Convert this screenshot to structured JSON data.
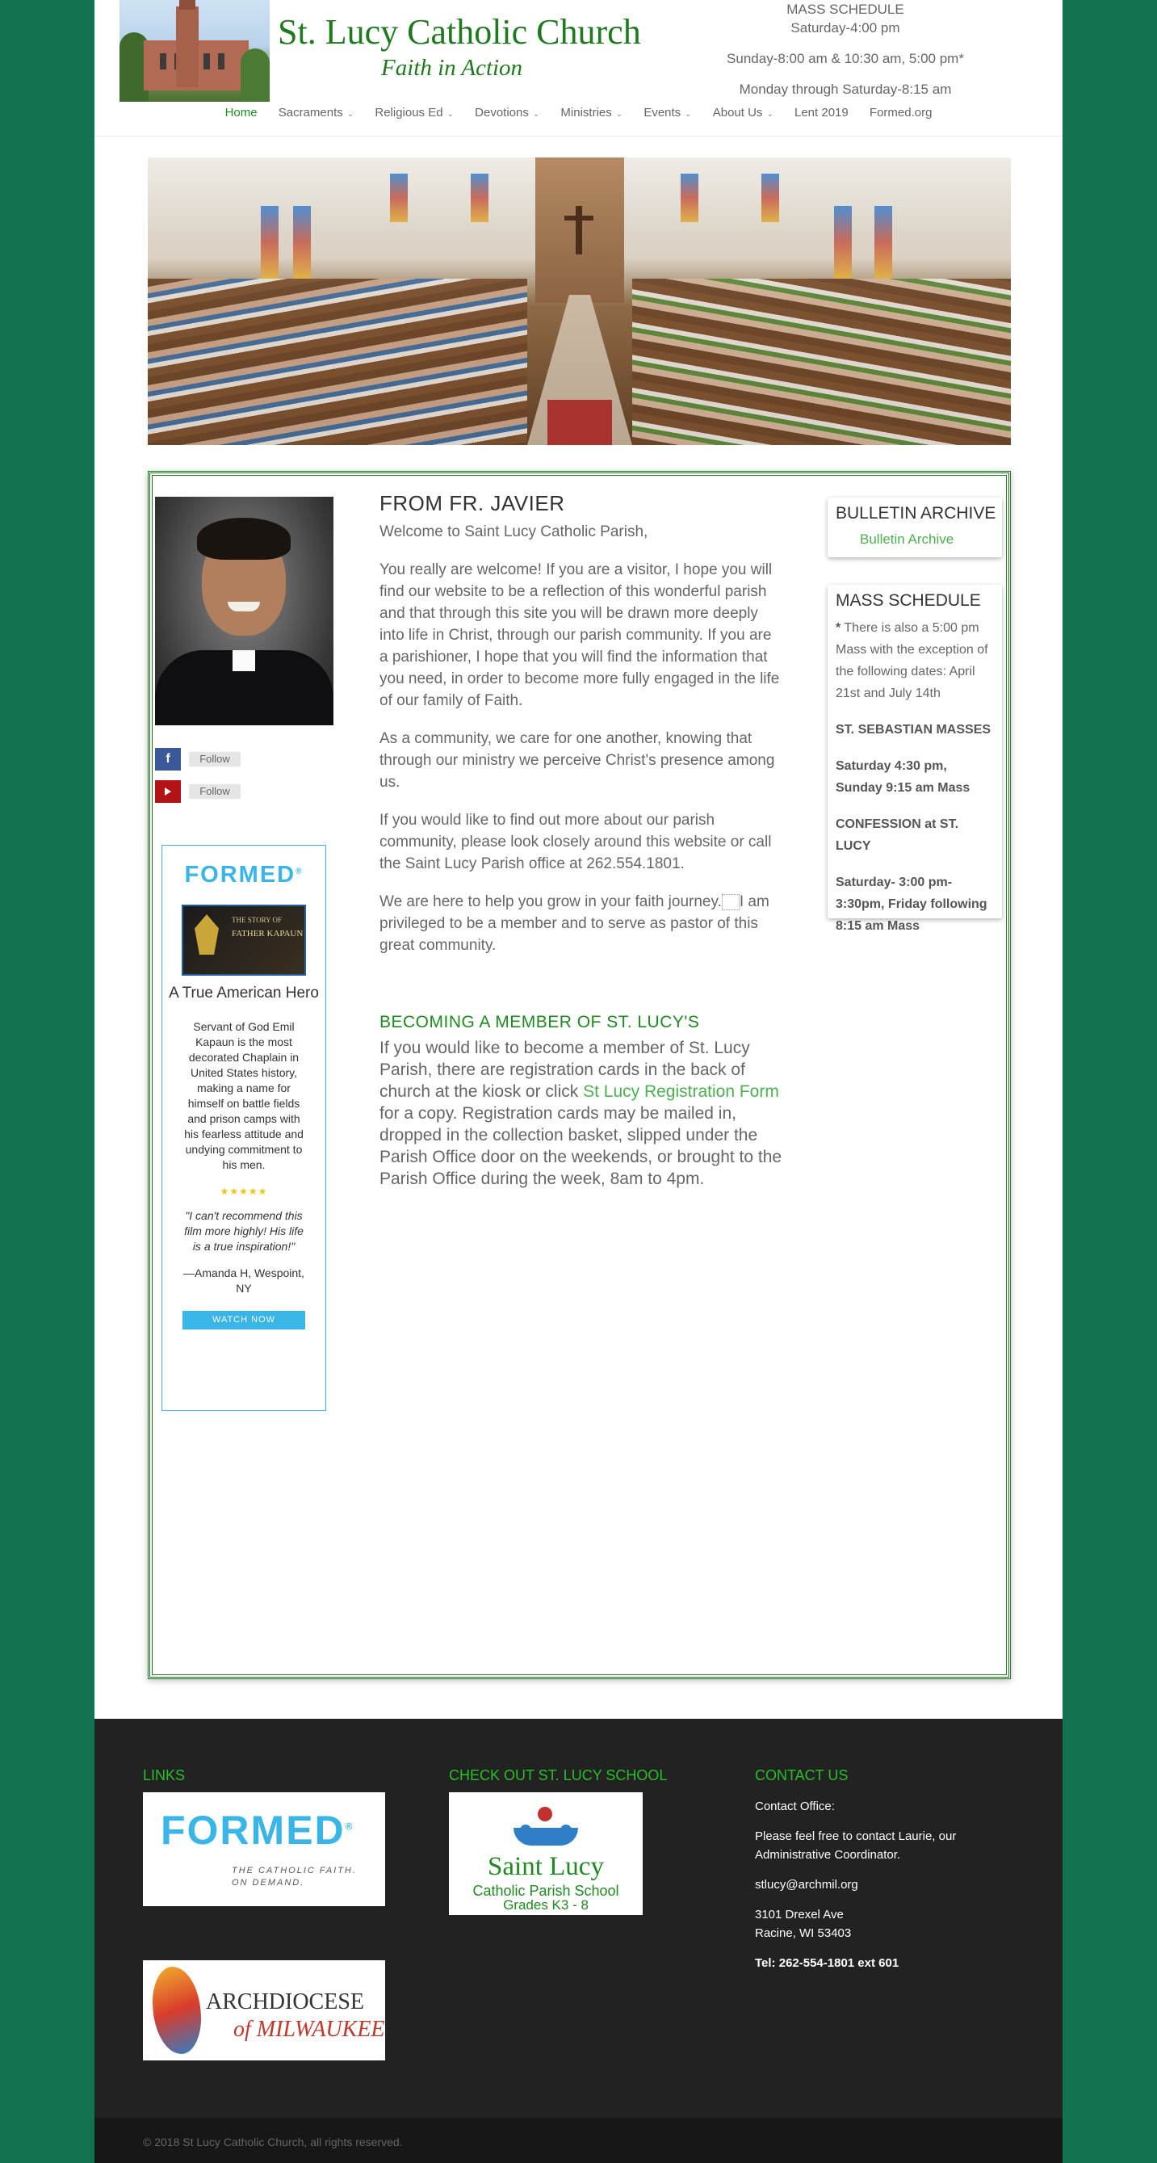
{
  "header": {
    "site_title": "St. Lucy Catholic Church",
    "tagline": "Faith in Action",
    "mass_schedule": {
      "heading": "MASS SCHEDULE",
      "saturday": "Saturday-4:00 pm",
      "sunday": "Sunday-8:00 am & 10:30 am, 5:00 pm*",
      "weekday": "Monday through Saturday-8:15 am"
    }
  },
  "nav": {
    "items": [
      {
        "label": "Home",
        "dropdown": false,
        "active": true
      },
      {
        "label": "Sacraments",
        "dropdown": true
      },
      {
        "label": "Religious Ed",
        "dropdown": true
      },
      {
        "label": "Devotions",
        "dropdown": true
      },
      {
        "label": "Ministries",
        "dropdown": true
      },
      {
        "label": "Events",
        "dropdown": true
      },
      {
        "label": "About Us",
        "dropdown": true
      },
      {
        "label": "Lent 2019",
        "dropdown": false
      },
      {
        "label": "Formed.org",
        "dropdown": false
      }
    ],
    "chevron_icon": "chevron-down-icon"
  },
  "sidebar": {
    "social": {
      "facebook": {
        "icon": "facebook-icon",
        "glyph": "f",
        "label": "Follow"
      },
      "youtube": {
        "icon": "youtube-icon",
        "label": "Follow"
      }
    },
    "formed_widget": {
      "logo_text": "FORMED",
      "logo_mark": "®",
      "poster_line1": "THE STORY OF",
      "poster_line2": "FATHER KAPAUN",
      "title": "A True American Hero",
      "description": "Servant of God Emil Kapaun is the most decorated Chaplain in United States history, making a name for himself on battle fields and prison camps with his fearless attitude and undying commitment to his men.",
      "stars": "★★★★★",
      "rating": 5,
      "quote": "\"I can't recommend this film more highly! His life is a true inspiration!\"",
      "author": "—Amanda H, Wespoint, NY",
      "button_label": "WATCH NOW"
    }
  },
  "main": {
    "title": "FROM FR. JAVIER",
    "welcome": "Welcome to Saint Lucy Catholic Parish,",
    "para1": "You really are welcome!  If you are a visitor, I hope you will find our website to be a reflection of this wonderful parish and that through this site you will be drawn more deeply into life in Christ, through our parish community. If you are a parishioner, I hope that you will find the information that you need, in order to become more fully engaged in the life of our family of Faith.",
    "para2": "As a community, we care for one another, knowing that through our ministry we perceive Christ's presence among us.",
    "para3": "If you would like to find out more about our parish community, please look closely around this website or call the Saint Lucy Parish office at 262.554.1801.",
    "para4_a": "We are here to help you grow in your faith journey.",
    "para4_b": "I am privileged to be a member and to serve as pastor of this great community.",
    "member_heading": "BECOMING A MEMBER OF ST. LUCY'S",
    "member_text_a": "If you would like to become a member of St. Lucy Parish, there are registration cards in the back of church at the kiosk or click ",
    "member_link": "St Lucy Registration Form",
    "member_text_b": " for a copy. Registration cards may be mailed in, dropped in the collection basket, slipped under the Parish Office door on the weekends, or brought to the Parish Office during the week, 8am to 4pm."
  },
  "bulletin": {
    "title": "BULLETIN ARCHIVE",
    "link": "Bulletin Archive"
  },
  "mass_card": {
    "title": "MASS SCHEDULE",
    "star": "*",
    "note": " There is also a 5:00 pm Mass with the exception of the following dates: April 21st and July 14th",
    "sebastian_heading": "ST. SEBASTIAN MASSES",
    "sebastian_times": "Saturday 4:30 pm, Sunday 9:15 am Mass",
    "confession_heading": "CONFESSION at ST. LUCY",
    "confession_times": "Saturday- 3:00 pm-3:30pm, Friday following 8:15 am Mass"
  },
  "footer": {
    "links_heading": "LINKS",
    "formed_big": "FORMED",
    "formed_mark": "®",
    "formed_sub1": "THE CATHOLIC FAITH.",
    "formed_sub2": "ON DEMAND.",
    "arch_line1": "ARCHDIOCESE",
    "arch_line2": "of MILWAUKEE",
    "school_heading": "CHECK OUT ST. LUCY SCHOOL",
    "school_name": "Saint Lucy",
    "school_sub": "Catholic Parish School",
    "school_grades": "Grades K3 - 8",
    "contact_heading": "CONTACT US",
    "contact_office": "Contact Office:",
    "contact_note": "Please feel free to contact Laurie, our Administrative Coordinator.",
    "email": "stlucy@archmil.org",
    "address1": "3101 Drexel Ave",
    "address2": "Racine, WI 53403",
    "tel": "Tel: 262-554-1801 ext 601",
    "copyright": "© 2018 St Lucy Catholic Church, all rights reserved."
  },
  "colors": {
    "background": "#127350",
    "brand_green": "#1f7a1f",
    "link_green": "#4caf50",
    "formed_blue": "#39b5e8",
    "footer_bg": "#222222"
  }
}
